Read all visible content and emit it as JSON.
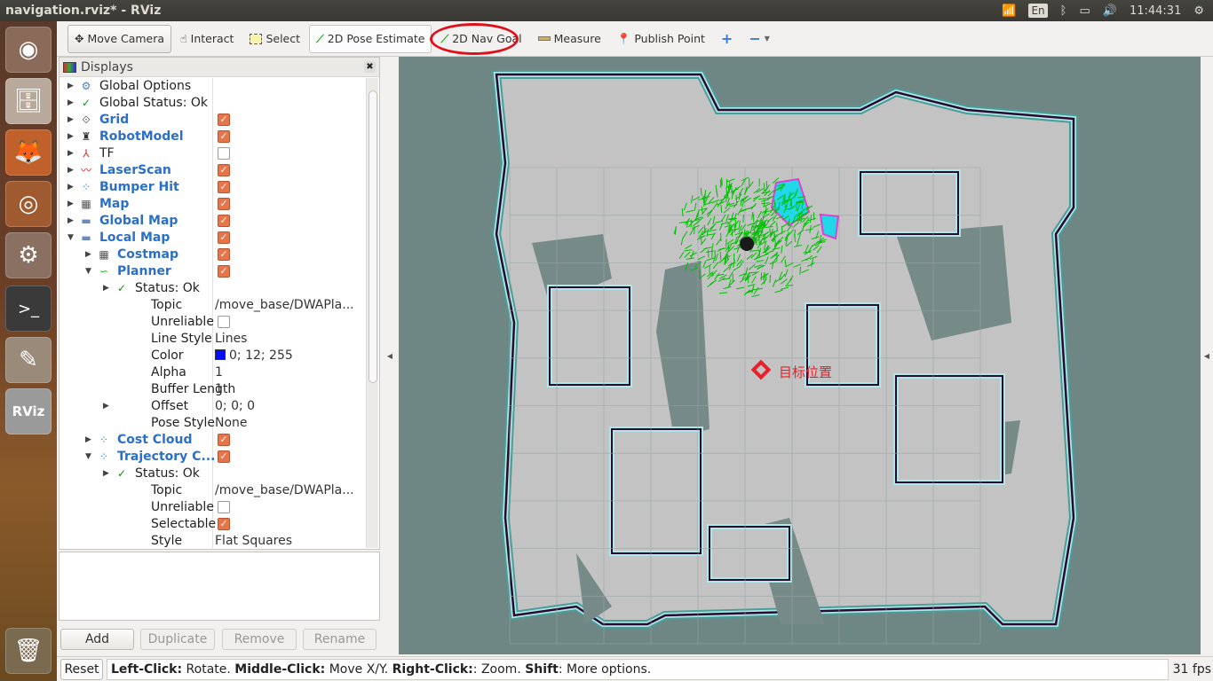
{
  "window": {
    "title": "navigation.rviz* - RViz"
  },
  "tray": {
    "input_method": "En",
    "clock": "11:44:31"
  },
  "launcher": [
    {
      "name": "ubuntu-dash"
    },
    {
      "name": "files"
    },
    {
      "name": "firefox"
    },
    {
      "name": "chrome"
    },
    {
      "name": "system-settings"
    },
    {
      "name": "terminal"
    },
    {
      "name": "text-editor"
    },
    {
      "name": "rviz",
      "label": "RViz"
    },
    {
      "name": "trash"
    }
  ],
  "toolbar": {
    "tools": [
      {
        "id": "move-camera",
        "label": "Move Camera",
        "icon": "move-icon",
        "active": true
      },
      {
        "id": "interact",
        "label": "Interact",
        "icon": "hand-icon"
      },
      {
        "id": "select",
        "label": "Select",
        "icon": "select-box-icon"
      },
      {
        "id": "pose-estimate",
        "label": "2D Pose Estimate",
        "icon": "green-arrow-icon"
      },
      {
        "id": "nav-goal",
        "label": "2D Nav Goal",
        "icon": "green-arrow-icon",
        "highlighted": true
      },
      {
        "id": "measure",
        "label": "Measure",
        "icon": "ruler-icon"
      },
      {
        "id": "publish-point",
        "label": "Publish Point",
        "icon": "map-pin-icon"
      }
    ],
    "add_symbol": "+",
    "remove_symbol": "−"
  },
  "displays": {
    "title": "Displays",
    "rows": [
      {
        "indent": 0,
        "exp": "▶",
        "icon": "gear-icon",
        "label": "Global Options"
      },
      {
        "indent": 0,
        "exp": "▶",
        "icon": "check-icon",
        "label": "Global Status: Ok"
      },
      {
        "indent": 0,
        "exp": "▶",
        "icon": "grid-icon",
        "label": "Grid",
        "blue": true,
        "check": true
      },
      {
        "indent": 0,
        "exp": "▶",
        "icon": "robot-icon",
        "label": "RobotModel",
        "blue": true,
        "check": true
      },
      {
        "indent": 0,
        "exp": "▶",
        "icon": "axes-icon",
        "label": "TF",
        "check": false
      },
      {
        "indent": 0,
        "exp": "▶",
        "icon": "laser-icon",
        "label": "LaserScan",
        "blue": true,
        "check": true
      },
      {
        "indent": 0,
        "exp": "▶",
        "icon": "points-icon",
        "label": "Bumper Hit",
        "blue": true,
        "check": true
      },
      {
        "indent": 0,
        "exp": "▶",
        "icon": "map-icon",
        "label": "Map",
        "blue": true,
        "check": true
      },
      {
        "indent": 0,
        "exp": "▶",
        "icon": "folder-icon",
        "label": "Global Map",
        "blue": true,
        "check": true
      },
      {
        "indent": 0,
        "exp": "▼",
        "icon": "folder-icon",
        "label": "Local Map",
        "blue": true,
        "check": true
      },
      {
        "indent": 1,
        "exp": "▶",
        "icon": "map-icon",
        "label": "Costmap",
        "blue": true,
        "check": true
      },
      {
        "indent": 1,
        "exp": "▼",
        "icon": "path-icon",
        "label": "Planner",
        "blue": true,
        "check": true
      },
      {
        "indent": 2,
        "exp": "▶",
        "icon": "check-icon",
        "label": "Status: Ok"
      },
      {
        "indent": 2,
        "label": "Topic",
        "value": "/move_base/DWAPla..."
      },
      {
        "indent": 2,
        "label": "Unreliable",
        "check": false
      },
      {
        "indent": 2,
        "label": "Line Style",
        "value": "Lines"
      },
      {
        "indent": 2,
        "label": "Color",
        "value": "0; 12; 255",
        "swatch": "#000cff"
      },
      {
        "indent": 2,
        "label": "Alpha",
        "value": "1"
      },
      {
        "indent": 2,
        "label": "Buffer Length",
        "value": "1"
      },
      {
        "indent": 2,
        "exp": "▶",
        "label": "Offset",
        "value": "0; 0; 0"
      },
      {
        "indent": 2,
        "label": "Pose Style",
        "value": "None"
      },
      {
        "indent": 1,
        "exp": "▶",
        "icon": "points-icon",
        "label": "Cost Cloud",
        "blue": true,
        "check": true
      },
      {
        "indent": 1,
        "exp": "▼",
        "icon": "points-icon",
        "label": "Trajectory C...",
        "blue": true,
        "check": true
      },
      {
        "indent": 2,
        "exp": "▶",
        "icon": "check-icon",
        "label": "Status: Ok"
      },
      {
        "indent": 2,
        "label": "Topic",
        "value": "/move_base/DWAPla..."
      },
      {
        "indent": 2,
        "label": "Unreliable",
        "check": false
      },
      {
        "indent": 2,
        "label": "Selectable",
        "check": true
      },
      {
        "indent": 2,
        "label": "Style",
        "value": "Flat Squares"
      }
    ],
    "buttons": {
      "add": "Add",
      "duplicate": "Duplicate",
      "remove": "Remove",
      "rename": "Rename"
    }
  },
  "status": {
    "reset": "Reset",
    "hint": [
      {
        "b": "Left-Click:",
        "t": " Rotate. "
      },
      {
        "b": "Middle-Click:",
        "t": " Move X/Y. "
      },
      {
        "b": "Right-Click:",
        "t": ": Zoom. "
      },
      {
        "b": "Shift",
        "t": ": More options."
      }
    ],
    "fps": "31 fps"
  },
  "viewport": {
    "goal_label": "目标位置",
    "colors": {
      "background": "#6e8784",
      "free": "#c3c3c3",
      "unknown_dark": "#768a88",
      "inflation": "#aee8e6",
      "inflation_edge": "#4c9c98",
      "obstacle": "#2a0a30",
      "particles": "#00c000",
      "goal": "#e8202a"
    }
  }
}
